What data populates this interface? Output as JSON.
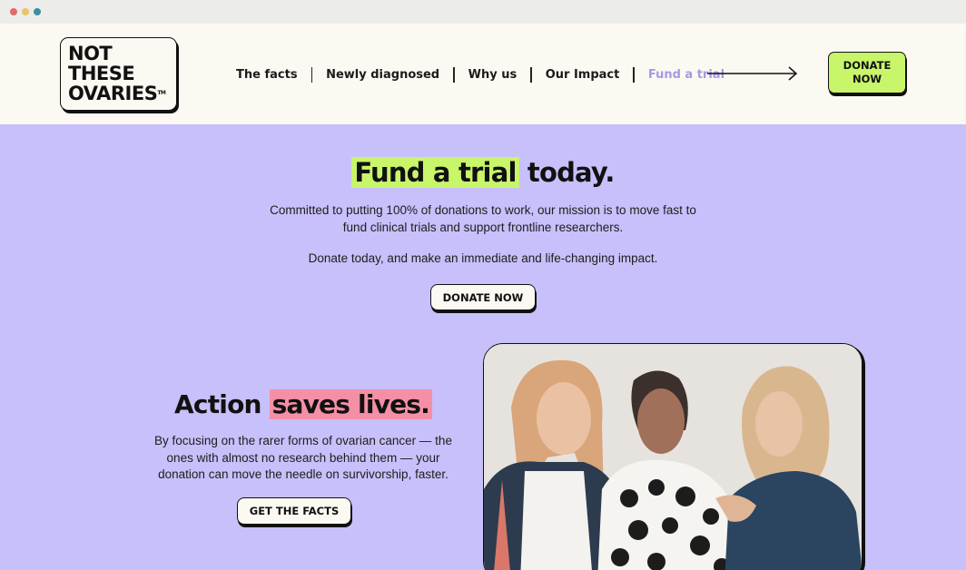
{
  "browser": {
    "window_controls": [
      "close",
      "minimize",
      "maximize"
    ]
  },
  "header": {
    "logo": {
      "lines": [
        "NOT",
        "THESE",
        "OVARIES"
      ],
      "trademark": "TM"
    },
    "nav": [
      {
        "label": "The facts",
        "active": false
      },
      {
        "label": "Newly diagnosed",
        "active": false
      },
      {
        "label": "Why us",
        "active": false
      },
      {
        "label": "Our Impact",
        "active": false
      },
      {
        "label": "Fund a trial",
        "active": true
      }
    ],
    "arrow_icon": "arrow-right-icon",
    "donate_button": "DONATE NOW"
  },
  "hero": {
    "title_highlight": "Fund a trial",
    "title_rest": " today.",
    "description_lines": [
      "Committed to putting 100% of donations to work, our mission is to move fast to",
      "fund clinical trials and support frontline researchers."
    ],
    "subtext": "Donate today, and make an immediate and life-changing impact.",
    "donate_button": "DONATE NOW"
  },
  "action": {
    "title_plain": "Action ",
    "title_highlight": "saves lives.",
    "description_lines": [
      "By focusing on the rarer forms of ovarian cancer — the",
      "ones with almost no research behind them — your",
      "donation can move the needle on survivorship, faster."
    ],
    "facts_button": "GET THE FACTS",
    "photo": "three-women-photo"
  },
  "colors": {
    "accent_green": "#c8f56a",
    "accent_pink": "#f48fa6",
    "hero_background": "#c8c0fa",
    "header_background": "#fcf9f3",
    "active_nav": "#a59ae6"
  }
}
